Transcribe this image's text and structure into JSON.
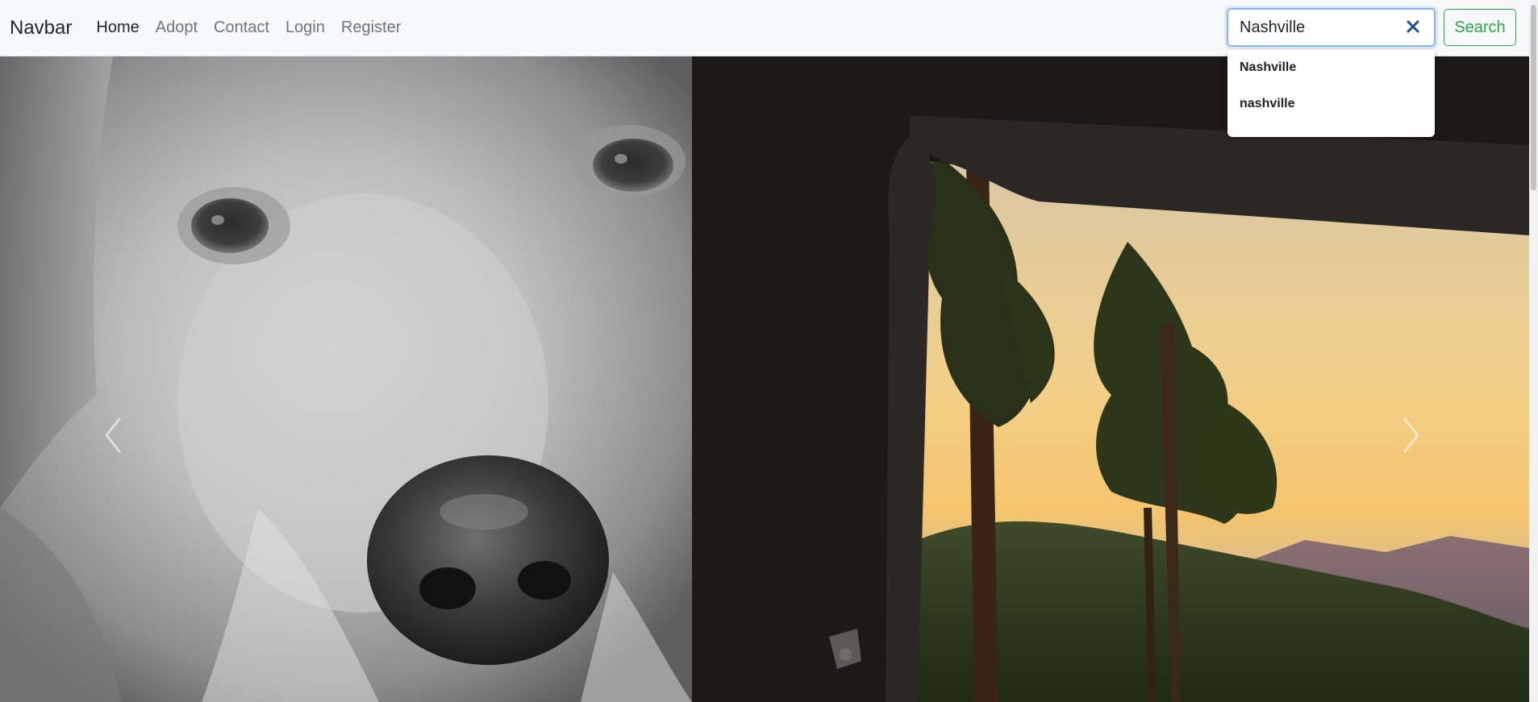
{
  "navbar": {
    "brand": "Navbar",
    "links": [
      {
        "label": "Home",
        "active": true
      },
      {
        "label": "Adopt",
        "active": false
      },
      {
        "label": "Contact",
        "active": false
      },
      {
        "label": "Login",
        "active": false
      },
      {
        "label": "Register",
        "active": false
      }
    ]
  },
  "search": {
    "value": "Nashville",
    "button_label": "Search",
    "suggestions": [
      "Nashville",
      "nashville"
    ]
  },
  "carousel": {
    "slide_count": 3,
    "active_index": 2
  },
  "colors": {
    "navbar_bg": "#f8f9fa",
    "search_button": "#28a745",
    "focus_ring": "#8ab4f8",
    "clear_icon": "#1a4f8a"
  },
  "icons": {
    "clear": "close-icon",
    "prev": "chevron-left-icon",
    "next": "chevron-right-icon"
  }
}
